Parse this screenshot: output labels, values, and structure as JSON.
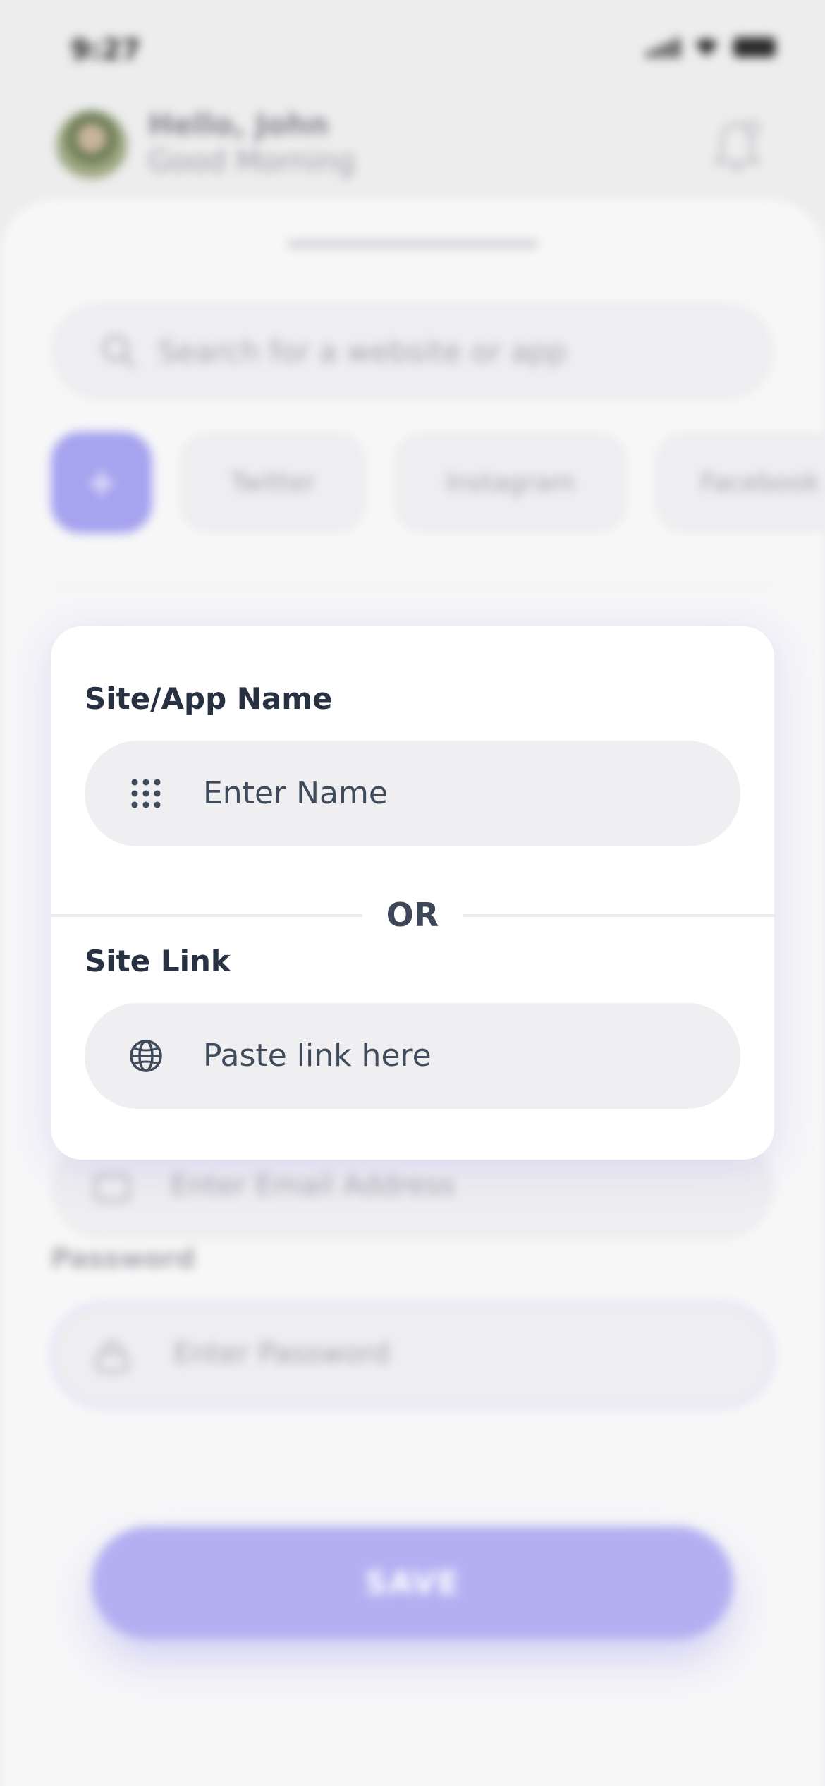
{
  "status_bar": {
    "time": "9:27"
  },
  "header": {
    "greeting": "Hello, John",
    "subtitle": "Good Morning"
  },
  "search": {
    "placeholder": "Search for a website or app"
  },
  "chips": [
    {
      "label": "+"
    },
    {
      "label": "Twitter"
    },
    {
      "label": "Instagram"
    },
    {
      "label": "Facebook"
    }
  ],
  "form": {
    "email_placeholder": "Enter Email Address",
    "password_label": "Password",
    "password_placeholder": "Enter Password",
    "save_label": "SAVE"
  },
  "modal": {
    "name_label": "Site/App Name",
    "name_placeholder": "Enter Name",
    "or_text": "OR",
    "link_label": "Site Link",
    "link_placeholder": "Paste link here"
  },
  "colors": {
    "accent": "#a6a3ef",
    "save_button": "#b3b0f2",
    "label_text": "#273141",
    "field_bg": "#efeff1"
  }
}
